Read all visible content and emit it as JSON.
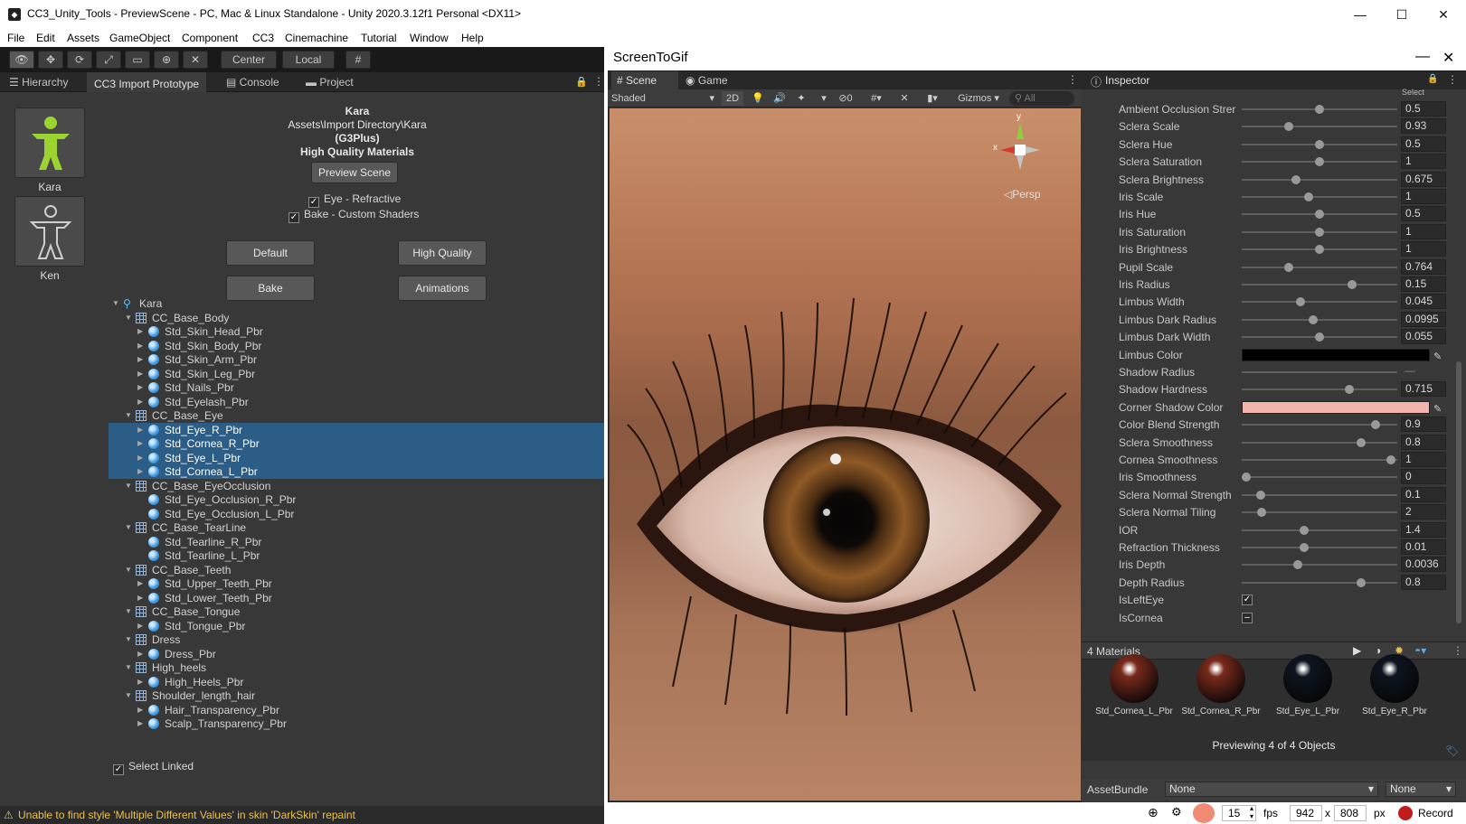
{
  "window": {
    "title": "CC3_Unity_Tools - PreviewScene - PC, Mac & Linux Standalone - Unity 2020.3.12f1 Personal <DX11>",
    "min_icon": "—",
    "max_icon": "☐",
    "close_icon": "✕"
  },
  "menu": [
    "File",
    "Edit",
    "Assets",
    "GameObject",
    "Component",
    "CC3",
    "Cinemachine",
    "Tutorial",
    "Window",
    "Help"
  ],
  "toolbar": {
    "center_label": "Center",
    "local_label": "Local"
  },
  "tabs": [
    {
      "label": "Hierarchy",
      "active": false
    },
    {
      "label": "CC3 Import Prototype",
      "active": true
    },
    {
      "label": "Console",
      "active": false
    },
    {
      "label": "Project",
      "active": false
    }
  ],
  "characters": [
    {
      "name": "Kara",
      "selected": true
    },
    {
      "name": "Ken",
      "selected": false
    }
  ],
  "info": {
    "name": "Kara",
    "path": "Assets\\Import Directory\\Kara",
    "generation": "(G3Plus)",
    "quality": "High Quality Materials"
  },
  "buttons": {
    "preview_scene": "Preview Scene",
    "default": "Default",
    "high_quality": "High Quality",
    "bake": "Bake",
    "animations": "Animations"
  },
  "checks": {
    "eye_refractive": "Eye - Refractive",
    "bake_custom": "Bake - Custom Shaders",
    "select_linked": "Select Linked"
  },
  "tree": [
    {
      "label": "Kara",
      "kind": "root",
      "depth": 0,
      "expanded": true,
      "selected": false
    },
    {
      "label": "CC_Base_Body",
      "kind": "mesh",
      "depth": 1,
      "expanded": true,
      "selected": false
    },
    {
      "label": "Std_Skin_Head_Pbr",
      "kind": "mat",
      "depth": 2,
      "expanded": false,
      "selected": false
    },
    {
      "label": "Std_Skin_Body_Pbr",
      "kind": "mat",
      "depth": 2,
      "expanded": false,
      "selected": false
    },
    {
      "label": "Std_Skin_Arm_Pbr",
      "kind": "mat",
      "depth": 2,
      "expanded": false,
      "selected": false
    },
    {
      "label": "Std_Skin_Leg_Pbr",
      "kind": "mat",
      "depth": 2,
      "expanded": false,
      "selected": false
    },
    {
      "label": "Std_Nails_Pbr",
      "kind": "mat",
      "depth": 2,
      "expanded": false,
      "selected": false
    },
    {
      "label": "Std_Eyelash_Pbr",
      "kind": "mat",
      "depth": 2,
      "expanded": false,
      "selected": false
    },
    {
      "label": "CC_Base_Eye",
      "kind": "mesh",
      "depth": 1,
      "expanded": true,
      "selected": false
    },
    {
      "label": "Std_Eye_R_Pbr",
      "kind": "mat",
      "depth": 2,
      "expanded": false,
      "selected": true
    },
    {
      "label": "Std_Cornea_R_Pbr",
      "kind": "mat",
      "depth": 2,
      "expanded": false,
      "selected": true
    },
    {
      "label": "Std_Eye_L_Pbr",
      "kind": "mat",
      "depth": 2,
      "expanded": false,
      "selected": true
    },
    {
      "label": "Std_Cornea_L_Pbr",
      "kind": "mat",
      "depth": 2,
      "expanded": false,
      "selected": true
    },
    {
      "label": "CC_Base_EyeOcclusion",
      "kind": "mesh",
      "depth": 1,
      "expanded": true,
      "selected": false
    },
    {
      "label": "Std_Eye_Occlusion_R_Pbr",
      "kind": "mat",
      "depth": 2,
      "expanded": null,
      "selected": false
    },
    {
      "label": "Std_Eye_Occlusion_L_Pbr",
      "kind": "mat",
      "depth": 2,
      "expanded": null,
      "selected": false
    },
    {
      "label": "CC_Base_TearLine",
      "kind": "mesh",
      "depth": 1,
      "expanded": true,
      "selected": false
    },
    {
      "label": "Std_Tearline_R_Pbr",
      "kind": "mat",
      "depth": 2,
      "expanded": null,
      "selected": false
    },
    {
      "label": "Std_Tearline_L_Pbr",
      "kind": "mat",
      "depth": 2,
      "expanded": null,
      "selected": false
    },
    {
      "label": "CC_Base_Teeth",
      "kind": "mesh",
      "depth": 1,
      "expanded": true,
      "selected": false
    },
    {
      "label": "Std_Upper_Teeth_Pbr",
      "kind": "mat",
      "depth": 2,
      "expanded": false,
      "selected": false
    },
    {
      "label": "Std_Lower_Teeth_Pbr",
      "kind": "mat",
      "depth": 2,
      "expanded": false,
      "selected": false
    },
    {
      "label": "CC_Base_Tongue",
      "kind": "mesh",
      "depth": 1,
      "expanded": true,
      "selected": false
    },
    {
      "label": "Std_Tongue_Pbr",
      "kind": "mat",
      "depth": 2,
      "expanded": false,
      "selected": false
    },
    {
      "label": "Dress",
      "kind": "mesh",
      "depth": 1,
      "expanded": true,
      "selected": false
    },
    {
      "label": "Dress_Pbr",
      "kind": "mat",
      "depth": 2,
      "expanded": false,
      "selected": false
    },
    {
      "label": "High_heels",
      "kind": "mesh",
      "depth": 1,
      "expanded": true,
      "selected": false
    },
    {
      "label": "High_Heels_Pbr",
      "kind": "mat",
      "depth": 2,
      "expanded": false,
      "selected": false
    },
    {
      "label": "Shoulder_length_hair",
      "kind": "mesh",
      "depth": 1,
      "expanded": true,
      "selected": false
    },
    {
      "label": "Hair_Transparency_Pbr",
      "kind": "mat",
      "depth": 2,
      "expanded": false,
      "selected": false
    },
    {
      "label": "Scalp_Transparency_Pbr",
      "kind": "mat",
      "depth": 2,
      "expanded": false,
      "selected": false
    }
  ],
  "status": "Unable to find style 'Multiple Different Values' in skin 'DarkSkin' repaint",
  "screentogif": {
    "title": "ScreenToGif",
    "fps_value": "15",
    "fps_label": "fps",
    "width": "942",
    "times": "x",
    "height": "808",
    "px_label": "px",
    "record_label": "Record"
  },
  "scene": {
    "tab_scene": "Scene",
    "tab_game": "Game",
    "shading": "Shaded",
    "two_d": "2D",
    "hidden_count": "0",
    "gizmos": "Gizmos",
    "search_placeholder": "All",
    "persp": "Persp",
    "axis_y": "y",
    "axis_x": "x"
  },
  "inspector": {
    "title": "Inspector",
    "select_cutoff": "Select",
    "properties": [
      {
        "label": "Ambient Occlusion Strer",
        "type": "slider",
        "fraction": 0.5,
        "value": "0.5"
      },
      {
        "label": "Sclera Scale",
        "type": "slider",
        "fraction": 0.3,
        "value": "0.93"
      },
      {
        "label": "Sclera Hue",
        "type": "slider",
        "fraction": 0.5,
        "value": "0.5"
      },
      {
        "label": "Sclera Saturation",
        "type": "slider",
        "fraction": 0.5,
        "value": "1"
      },
      {
        "label": "Sclera Brightness",
        "type": "slider",
        "fraction": 0.35,
        "value": "0.675"
      },
      {
        "label": "Iris Scale",
        "type": "slider",
        "fraction": 0.43,
        "value": "1"
      },
      {
        "label": "Iris Hue",
        "type": "slider",
        "fraction": 0.5,
        "value": "0.5"
      },
      {
        "label": "Iris Saturation",
        "type": "slider",
        "fraction": 0.5,
        "value": "1"
      },
      {
        "label": "Iris Brightness",
        "type": "slider",
        "fraction": 0.5,
        "value": "1"
      },
      {
        "label": "Pupil Scale",
        "type": "slider",
        "fraction": 0.3,
        "value": "0.764"
      },
      {
        "label": "Iris Radius",
        "type": "slider",
        "fraction": 0.71,
        "value": "0.15"
      },
      {
        "label": "Limbus Width",
        "type": "slider",
        "fraction": 0.38,
        "value": "0.045"
      },
      {
        "label": "Limbus Dark Radius",
        "type": "slider",
        "fraction": 0.46,
        "value": "0.0995"
      },
      {
        "label": "Limbus Dark Width",
        "type": "slider",
        "fraction": 0.5,
        "value": "0.055"
      },
      {
        "label": "Limbus Color",
        "type": "color",
        "color": "#000000"
      },
      {
        "label": "Shadow Radius",
        "type": "slider-empty",
        "value": "—"
      },
      {
        "label": "Shadow Hardness",
        "type": "slider",
        "fraction": 0.69,
        "value": "0.715"
      },
      {
        "label": "Corner Shadow Color",
        "type": "color",
        "color": "#f4b4ae"
      },
      {
        "label": "Color Blend Strength",
        "type": "slider",
        "fraction": 0.86,
        "value": "0.9"
      },
      {
        "label": "Sclera Smoothness",
        "type": "slider",
        "fraction": 0.77,
        "value": "0.8"
      },
      {
        "label": "Cornea Smoothness",
        "type": "slider",
        "fraction": 0.96,
        "value": "1"
      },
      {
        "label": "Iris Smoothness",
        "type": "slider",
        "fraction": 0.03,
        "value": "0"
      },
      {
        "label": "Sclera Normal Strength",
        "type": "slider",
        "fraction": 0.12,
        "value": "0.1"
      },
      {
        "label": "Sclera Normal Tiling",
        "type": "slider",
        "fraction": 0.13,
        "value": "2"
      },
      {
        "label": "IOR",
        "type": "slider",
        "fraction": 0.4,
        "value": "1.4"
      },
      {
        "label": "Refraction Thickness",
        "type": "slider",
        "fraction": 0.4,
        "value": "0.01"
      },
      {
        "label": "Iris Depth",
        "type": "slider",
        "fraction": 0.36,
        "value": "0.0036"
      },
      {
        "label": "Depth Radius",
        "type": "slider",
        "fraction": 0.77,
        "value": "0.8"
      },
      {
        "label": "IsLeftEye",
        "type": "check",
        "checked": true
      },
      {
        "label": "IsCornea",
        "type": "check-mixed",
        "checked": null
      }
    ],
    "materials_header": "4 Materials",
    "materials": [
      {
        "label": "Std_Cornea_L_Pbr",
        "color": "#7a2a1c"
      },
      {
        "label": "Std_Cornea_R_Pbr",
        "color": "#7a2a1c"
      },
      {
        "label": "Std_Eye_L_Pbr",
        "color": "#0e1420"
      },
      {
        "label": "Std_Eye_R_Pbr",
        "color": "#0e1420"
      }
    ],
    "previewing": "Previewing 4 of 4 Objects",
    "assetbundle_label": "AssetBundle",
    "assetbundle_value": "None",
    "assetbundle_variant": "None"
  },
  "colors": {
    "accent_select": "#2c5d87",
    "warning": "#e7c34a",
    "record": "#c21b1b"
  }
}
